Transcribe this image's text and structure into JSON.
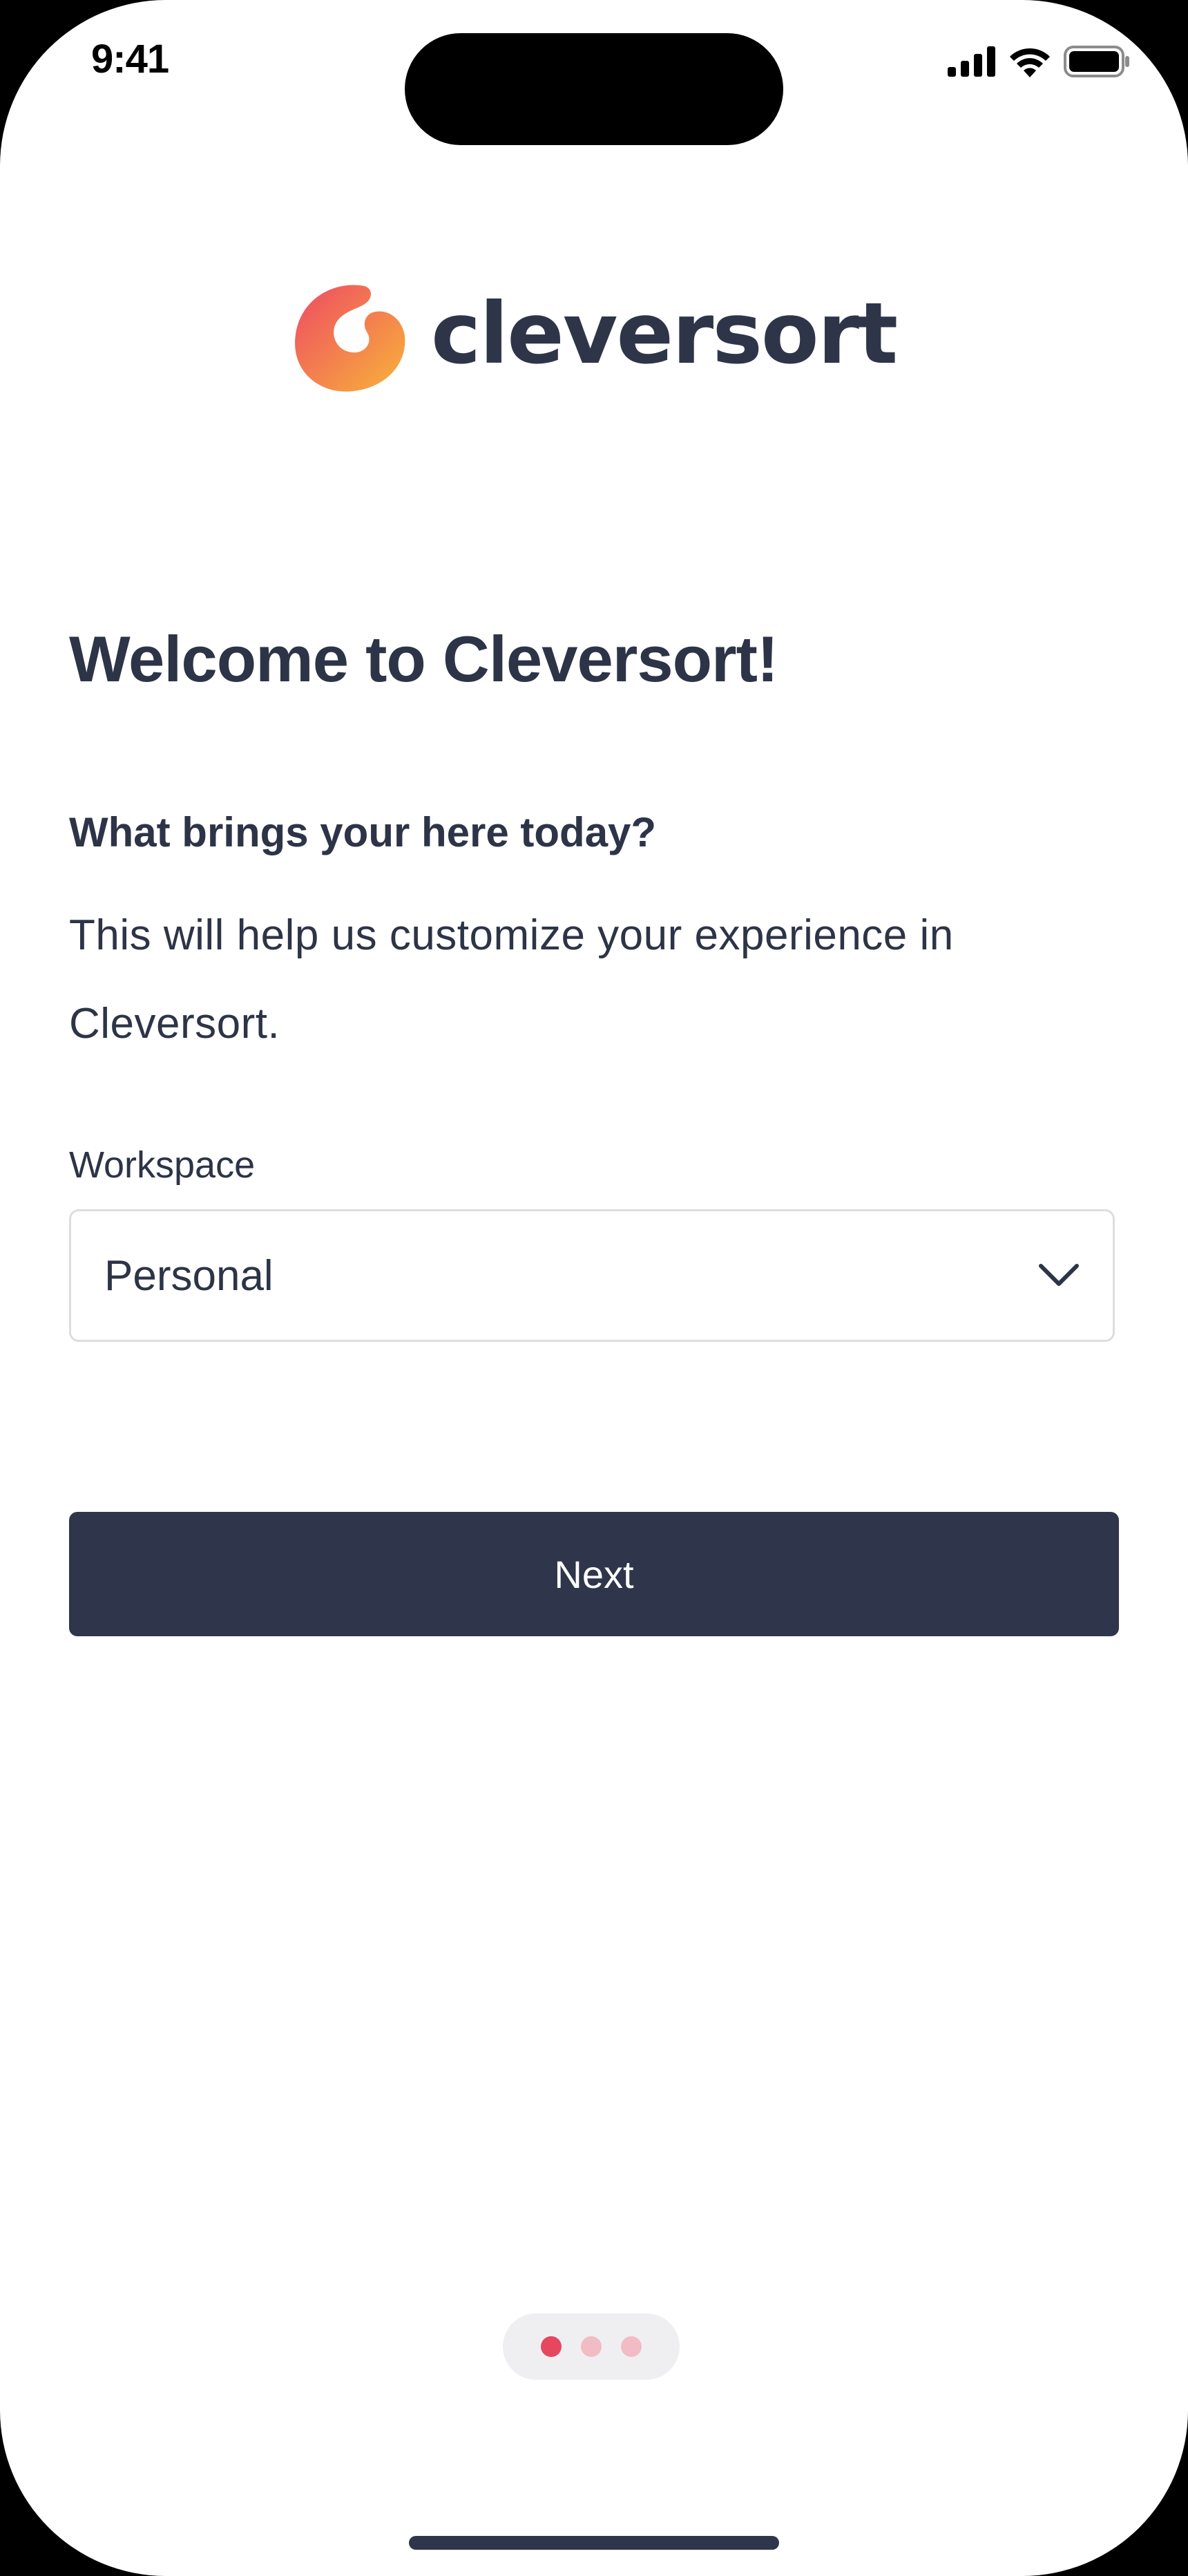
{
  "status_bar": {
    "time": "9:41"
  },
  "logo": {
    "wordmark": "cleversort",
    "icon": "cleversort-logo-icon"
  },
  "welcome": {
    "title": "Welcome to Cleversort!",
    "question": "What brings your here today?",
    "help_text": "This will help us customize your experience in Cleversort."
  },
  "workspace_field": {
    "label": "Workspace",
    "value": "Personal",
    "icon": "chevron-down-icon"
  },
  "next_button": {
    "label": "Next"
  },
  "pager": {
    "total": 3,
    "active_index": 0
  },
  "colors": {
    "primary_dark": "#2f364b",
    "text": "#2d3447",
    "accent_dot_active": "#e6475e",
    "accent_dot_inactive": "#f2bcc4",
    "logo_gradient_start": "#ee4a63",
    "logo_gradient_end": "#f8b43a"
  }
}
